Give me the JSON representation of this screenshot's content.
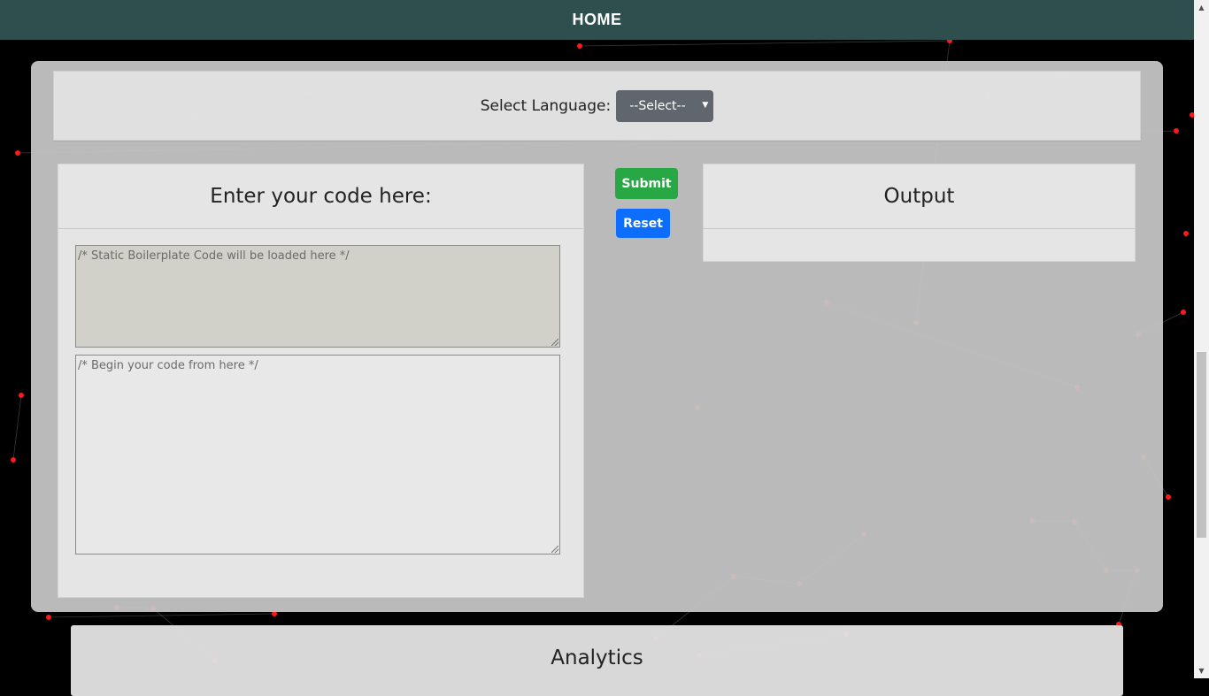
{
  "nav": {
    "home_label": "HOME"
  },
  "language": {
    "label": "Select Language:",
    "selected": "--Select--"
  },
  "editor": {
    "title": "Enter your code here:",
    "boilerplate_placeholder": "/* Static Boilerplate Code will be loaded here */",
    "code_placeholder": "/* Begin your code from here */"
  },
  "actions": {
    "submit_label": "Submit",
    "reset_label": "Reset"
  },
  "output": {
    "title": "Output"
  },
  "analytics": {
    "title": "Analytics"
  },
  "colors": {
    "navbar": "#2f4f4f",
    "submit": "#28a745",
    "reset": "#0d6efd",
    "select": "#5f666d",
    "background": "#000000",
    "particle": "#ff1a1a"
  }
}
